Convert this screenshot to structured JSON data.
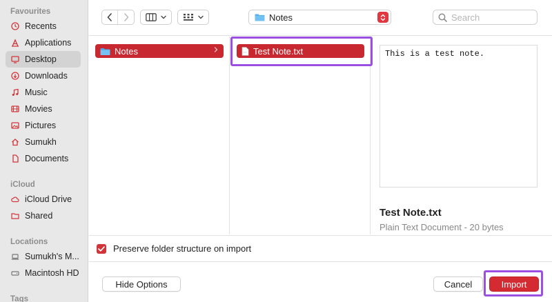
{
  "sidebar": {
    "sections": [
      {
        "title": "Favourites",
        "items": [
          {
            "label": "Recents",
            "icon": "clock-icon"
          },
          {
            "label": "Applications",
            "icon": "apps-icon"
          },
          {
            "label": "Desktop",
            "icon": "desktop-icon",
            "selected": true
          },
          {
            "label": "Downloads",
            "icon": "download-icon"
          },
          {
            "label": "Music",
            "icon": "music-icon"
          },
          {
            "label": "Movies",
            "icon": "film-icon"
          },
          {
            "label": "Pictures",
            "icon": "picture-icon"
          },
          {
            "label": "Sumukh",
            "icon": "home-icon"
          },
          {
            "label": "Documents",
            "icon": "document-icon"
          }
        ]
      },
      {
        "title": "iCloud",
        "items": [
          {
            "label": "iCloud Drive",
            "icon": "cloud-icon"
          },
          {
            "label": "Shared",
            "icon": "shared-folder-icon"
          }
        ]
      },
      {
        "title": "Locations",
        "items": [
          {
            "label": "Sumukh's M...",
            "icon": "laptop-icon"
          },
          {
            "label": "Macintosh HD",
            "icon": "disk-icon"
          }
        ]
      },
      {
        "title": "Tags",
        "items": []
      }
    ]
  },
  "toolbar": {
    "path_label": "Notes",
    "search_placeholder": "Search"
  },
  "browser": {
    "column1_item": "Notes",
    "column2_item": "Test Note.txt"
  },
  "preview": {
    "content": "This is a test note.",
    "file_name": "Test Note.txt",
    "file_meta": "Plain Text Document - 20 bytes"
  },
  "options": {
    "preserve_label": "Preserve folder structure on import",
    "preserve_checked": true
  },
  "buttons": {
    "hide_options": "Hide Options",
    "cancel": "Cancel",
    "import": "Import"
  },
  "colors": {
    "accent": "#d42a32",
    "selection": "#c8282f",
    "highlight": "#9b4fe0",
    "sidebar_bg": "#e9e8e8"
  }
}
